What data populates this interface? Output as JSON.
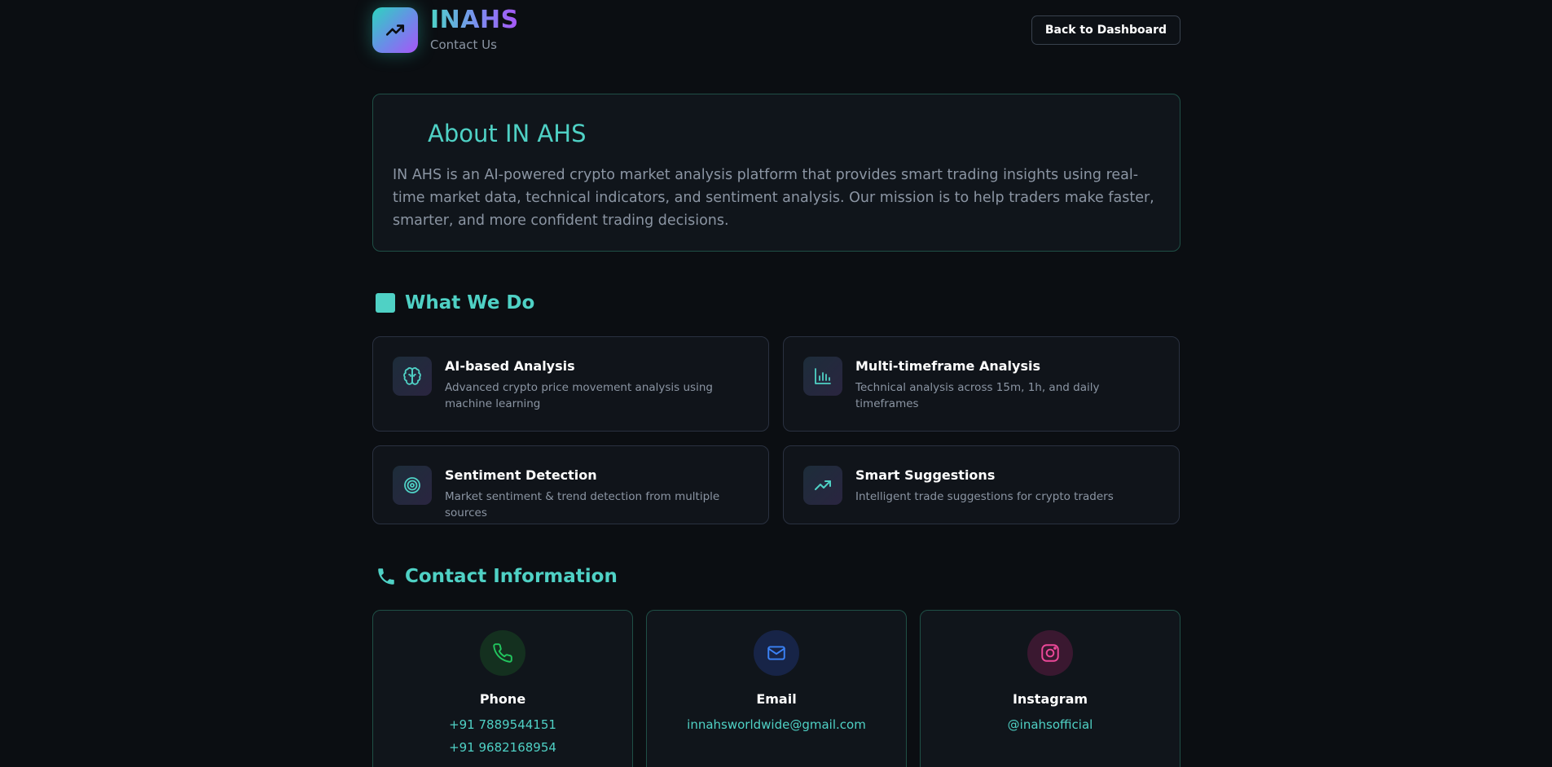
{
  "header": {
    "brand": "INAHS",
    "subtitle": "Contact Us",
    "back_button": "Back to Dashboard",
    "logo_icon": "trending-up-icon"
  },
  "about": {
    "title": "About IN AHS",
    "text": "IN AHS is an AI-powered crypto market analysis platform that provides smart trading insights using real-time market data, technical indicators, and sentiment analysis. Our mission is to help traders make faster, smarter, and more confident trading decisions."
  },
  "what_we_do": {
    "heading": "What We Do",
    "features": [
      {
        "title": "AI-based Analysis",
        "description": "Advanced crypto price movement analysis using machine learning",
        "icon": "brain-icon"
      },
      {
        "title": "Multi-timeframe Analysis",
        "description": "Technical analysis across 15m, 1h, and daily timeframes",
        "icon": "bar-chart-icon"
      },
      {
        "title": "Sentiment Detection",
        "description": "Market sentiment & trend detection from multiple sources",
        "icon": "target-icon"
      },
      {
        "title": "Smart Suggestions",
        "description": "Intelligent trade suggestions for crypto traders",
        "icon": "trending-up-icon"
      }
    ]
  },
  "contact": {
    "heading": "Contact Information",
    "cards": [
      {
        "title": "Phone",
        "values": [
          "+91 7889544151",
          "+91 9682168954"
        ],
        "icon": "phone-icon",
        "color": "#22c55e"
      },
      {
        "title": "Email",
        "values": [
          "innahsworldwide@gmail.com"
        ],
        "icon": "mail-icon",
        "color": "#3b82f6"
      },
      {
        "title": "Instagram",
        "values": [
          "@inahsofficial"
        ],
        "icon": "instagram-icon",
        "color": "#ec4899"
      }
    ]
  },
  "colors": {
    "accent": "#4fd1c5",
    "background": "#0b0e12",
    "card": "#10151b",
    "muted_text": "#8b95a3"
  }
}
